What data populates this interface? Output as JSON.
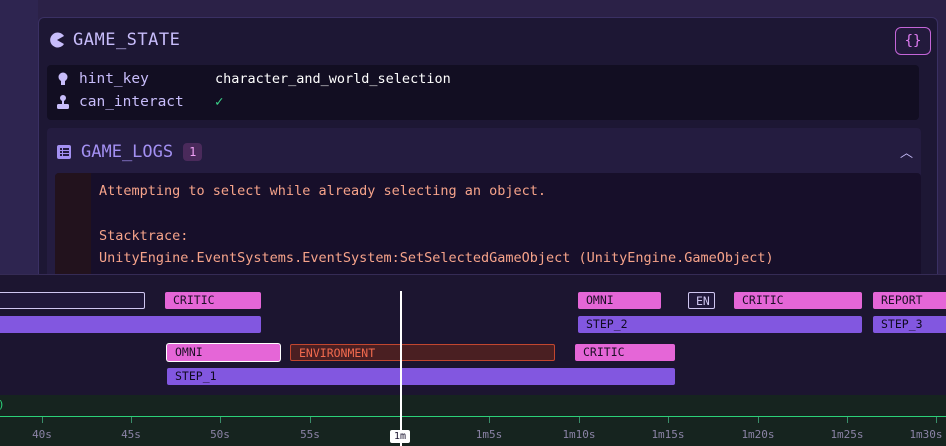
{
  "game_state": {
    "title": "GAME_STATE",
    "json_button": "{}",
    "rows": [
      {
        "key": "hint_key",
        "value": "character_and_world_selection",
        "icon": "lightbulb-icon"
      },
      {
        "key": "can_interact",
        "value": "✓",
        "icon": "joystick-icon"
      }
    ]
  },
  "game_logs": {
    "title": "GAME_LOGS",
    "count": "1",
    "lines": [
      "Attempting to select while already selecting an object.",
      "",
      "Stacktrace:",
      "UnityEngine.EventSystems.EventSystem:SetSelectedGameObject (UnityEngine.GameObject)"
    ]
  },
  "timeline": {
    "track1": [
      "",
      "CRITIC",
      "OMNI",
      "EN",
      "CRITIC",
      "REPORT"
    ],
    "track2": [
      "",
      "STEP_2",
      "STEP_3"
    ],
    "track3": [
      "OMNI",
      "ENVIRONMENT",
      "CRITIC"
    ],
    "track4": [
      "STEP_1"
    ],
    "cursor_label": "1m",
    "ticks": [
      "40s",
      "45s",
      "50s",
      "55s",
      "1m5s",
      "1m10s",
      "1m15s",
      "1m20s",
      "1m25s",
      "1m30s"
    ],
    "left_marker": ")"
  }
}
